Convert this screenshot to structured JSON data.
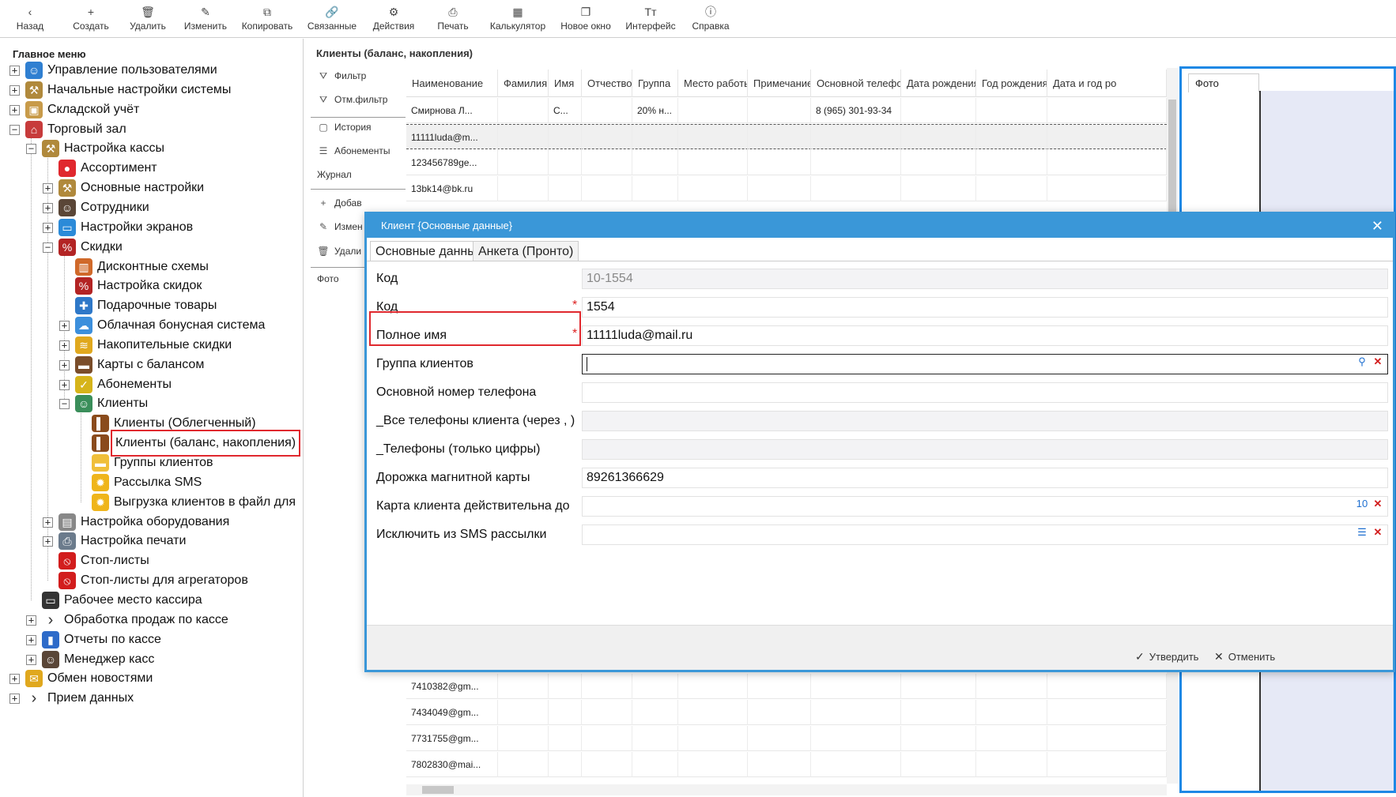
{
  "toolbar": {
    "back": {
      "label": "Назад",
      "icon": "‹"
    },
    "create": {
      "label": "Создать",
      "icon": "+"
    },
    "delete": {
      "label": "Удалить",
      "icon": "🗑"
    },
    "edit": {
      "label": "Изменить",
      "icon": "✎"
    },
    "copy": {
      "label": "Копировать",
      "icon": "⧉"
    },
    "related": {
      "label": "Связанные",
      "icon": "🔗"
    },
    "actions": {
      "label": "Действия",
      "icon": "⚙"
    },
    "print": {
      "label": "Печать",
      "icon": "⎙"
    },
    "calculator": {
      "label": "Калькулятор",
      "icon": "▦"
    },
    "new_window": {
      "label": "Новое окно",
      "icon": "❐"
    },
    "interface": {
      "label": "Интерфейс",
      "icon": "Tт"
    },
    "help": {
      "label": "Справка",
      "icon": "ⓘ"
    }
  },
  "left_panel": {
    "title": "Главное меню",
    "items": [
      {
        "label": "Управление пользователями",
        "icon": "user-icon",
        "glyph": "☺",
        "color": "#2f7fd1"
      },
      {
        "label": "Начальные настройки системы",
        "icon": "tools-icon",
        "glyph": "⚒",
        "color": "#b0893c"
      },
      {
        "label": "Складской учёт",
        "icon": "boxes-icon",
        "glyph": "▣",
        "color": "#c89b4a"
      },
      {
        "label": "Торговый зал",
        "icon": "shop-icon",
        "glyph": "⌂",
        "color": "#c73b3b"
      },
      {
        "label": "Настройка кассы",
        "icon": "tools-icon",
        "glyph": "⚒",
        "color": "#b0893c"
      },
      {
        "label": "Ассортимент",
        "icon": "apple-icon",
        "glyph": "●",
        "color": "#e0282e"
      },
      {
        "label": "Основные настройки",
        "icon": "tools-icon",
        "glyph": "⚒",
        "color": "#b0893c"
      },
      {
        "label": "Сотрудники",
        "icon": "employee-icon",
        "glyph": "☺",
        "color": "#5a4637"
      },
      {
        "label": "Настройки экранов",
        "icon": "monitor-icon",
        "glyph": "▭",
        "color": "#2b8ad8"
      },
      {
        "label": "Скидки",
        "icon": "discount-icon",
        "glyph": "%",
        "color": "#b32424"
      },
      {
        "label": "Дисконтные схемы",
        "icon": "books-icon",
        "glyph": "▥",
        "color": "#d0692a"
      },
      {
        "label": "Настройка скидок",
        "icon": "discount-icon",
        "glyph": "%",
        "color": "#b32424"
      },
      {
        "label": "Подарочные товары",
        "icon": "gift-icon",
        "glyph": "✚",
        "color": "#2e78c8"
      },
      {
        "label": "Облачная бонусная система",
        "icon": "cloud-icon",
        "glyph": "☁",
        "color": "#3c8fdc"
      },
      {
        "label": "Накопительные скидки",
        "icon": "layers-icon",
        "glyph": "≋",
        "color": "#e0a81e"
      },
      {
        "label": "Карты с балансом",
        "icon": "wallet-icon",
        "glyph": "▬",
        "color": "#7a4d2a"
      },
      {
        "label": "Абонементы",
        "icon": "ticket-icon",
        "glyph": "✓",
        "color": "#d6b41a"
      },
      {
        "label": "Клиенты",
        "icon": "clients-icon",
        "glyph": "☺",
        "color": "#3a8e5a"
      },
      {
        "label": "Клиенты (Облегченный)",
        "icon": "address-book-icon",
        "glyph": "▌",
        "color": "#8a4b1c"
      },
      {
        "label": "Клиенты (баланс, накопления)",
        "icon": "address-book-icon",
        "glyph": "▌",
        "color": "#8a4b1c"
      },
      {
        "label": "Группы клиентов",
        "icon": "folder-icon",
        "glyph": "▬",
        "color": "#f0bf3a"
      },
      {
        "label": "Рассылка SMS",
        "icon": "sun-gear-icon",
        "glyph": "✹",
        "color": "#efb51b"
      },
      {
        "label": "Выгрузка клиентов в файл для",
        "icon": "sun-gear-icon",
        "glyph": "✹",
        "color": "#efb51b"
      },
      {
        "label": "Настройка оборудования",
        "icon": "cash-register-icon",
        "glyph": "▤",
        "color": "#888888"
      },
      {
        "label": "Настройка печати",
        "icon": "printer-icon",
        "glyph": "⎙",
        "color": "#6b7b8c"
      },
      {
        "label": "Стоп-листы",
        "icon": "stop-icon",
        "glyph": "⦸",
        "color": "#d21d1d"
      },
      {
        "label": "Стоп-листы для агрегаторов",
        "icon": "stop-icon",
        "glyph": "⦸",
        "color": "#d21d1d"
      },
      {
        "label": "Рабочее место кассира",
        "icon": "monitor-icon",
        "glyph": "▭",
        "color": "#333333"
      },
      {
        "label": "Обработка продаж по кассе",
        "icon": "chevron-right-icon",
        "glyph": "›",
        "color": "#ffffff"
      },
      {
        "label": "Отчеты по кассе",
        "icon": "bar-chart-icon",
        "glyph": "▮",
        "color": "#2e6bc9"
      },
      {
        "label": "Менеджер касс",
        "icon": "manager-icon",
        "glyph": "☺",
        "color": "#5a4637"
      },
      {
        "label": "Обмен новостями",
        "icon": "news-icon",
        "glyph": "✉",
        "color": "#e0a81e"
      },
      {
        "label": "Прием данных",
        "icon": "chevron-right-icon",
        "glyph": "›",
        "color": "#ffffff"
      }
    ]
  },
  "main": {
    "title": "Клиенты (баланс, накопления)",
    "side_actions": [
      "Фильтр",
      "Отм.фильтр",
      "История",
      "Абонементы",
      "Журнал",
      "Добав",
      "Измен",
      "Удали",
      "Фото"
    ],
    "columns": [
      "Наименование",
      "Фамилия",
      "Имя",
      "Отчество",
      "Группа",
      "Место работы",
      "Примечание",
      "Основной телефон",
      "Дата рождения",
      "Год рождения",
      "Дата и год ро"
    ],
    "rows_top": [
      [
        "Смирнова Л...",
        "",
        "С...",
        "",
        "20% н...",
        "",
        "",
        "8 (965) 301-93-34",
        "",
        "",
        ""
      ],
      [
        "11111luda@m...",
        "",
        "",
        "",
        "",
        "",
        "",
        "",
        "",
        "",
        ""
      ],
      [
        "123456789ge...",
        "",
        "",
        "",
        "",
        "",
        "",
        "",
        "",
        "",
        ""
      ],
      [
        "13bk14@bk.ru",
        "",
        "",
        "",
        "",
        "",
        "",
        "",
        "",
        "",
        ""
      ]
    ],
    "rows_bottom": [
      [
        "7410382@gm...",
        "",
        "",
        "",
        "",
        "",
        "",
        "",
        "",
        "",
        ""
      ],
      [
        "7434049@gm...",
        "",
        "",
        "",
        "",
        "",
        "",
        "",
        "",
        "",
        ""
      ],
      [
        "7731755@gm...",
        "",
        "",
        "",
        "",
        "",
        "",
        "",
        "",
        "",
        ""
      ],
      [
        "7802830@mai...",
        "",
        "",
        "",
        "",
        "",
        "",
        "",
        "",
        "",
        ""
      ]
    ],
    "photo_tab": "Фото"
  },
  "dialog": {
    "title": "Клиент {Основные данные}",
    "tabs": [
      "Основные данные",
      "Анкета (Пронто)"
    ],
    "fields": [
      {
        "label": "Код",
        "value": "10-1554",
        "required": false,
        "state": "readonly"
      },
      {
        "label": "Код",
        "value": "1554",
        "required": true,
        "state": "normal"
      },
      {
        "label": "Полное имя",
        "value": "11111luda@mail.ru",
        "required": true,
        "state": "normal"
      },
      {
        "label": "Группа клиентов",
        "value": "",
        "required": false,
        "state": "focus"
      },
      {
        "label": "Основной номер телефона",
        "value": "",
        "required": false,
        "state": "normal"
      },
      {
        "label": "_Все телефоны клиента (через , )",
        "value": "",
        "required": false,
        "state": "grey"
      },
      {
        "label": "_Телефоны (только цифры)",
        "value": "",
        "required": false,
        "state": "grey"
      },
      {
        "label": "Дорожка магнитной карты",
        "value": "89261366629",
        "required": false,
        "state": "normal"
      },
      {
        "label": "Карта клиента действительна до",
        "value": "",
        "required": false,
        "state": "normal"
      },
      {
        "label": "Исключить из SMS рассылки",
        "value": "",
        "required": false,
        "state": "normal"
      }
    ],
    "required_mark": "*",
    "calendar_day": "10",
    "confirm_label": "Утвердить",
    "cancel_label": "Отменить"
  },
  "colors": {
    "accent": "#3a97d8",
    "highlight": "#e0282e",
    "required": "#dd2222"
  }
}
